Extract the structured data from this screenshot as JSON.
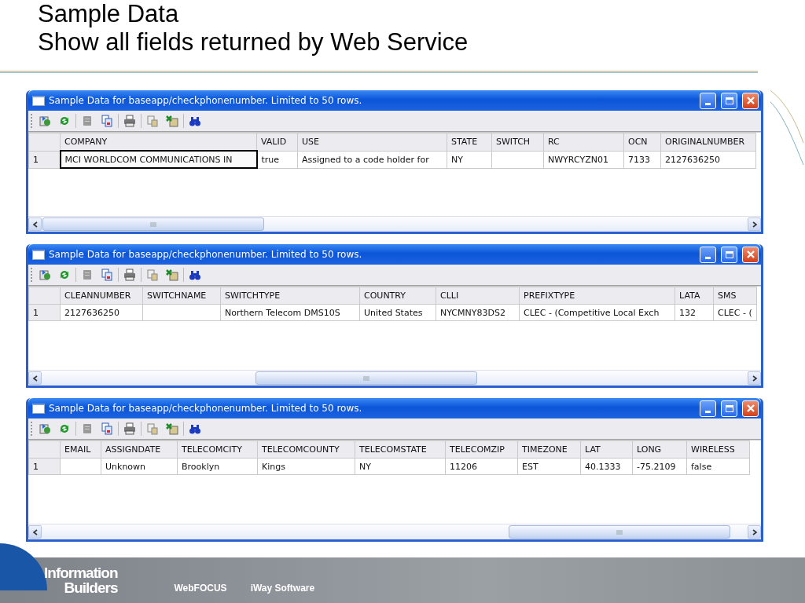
{
  "slide": {
    "title_lines": [
      "Sample Data",
      "Show all fields returned by Web Service"
    ]
  },
  "windows": [
    {
      "title": "Sample Data for baseapp/checkphonenumber. Limited to 50 rows.",
      "columns": [
        "COMPANY",
        "VALID",
        "USE",
        "STATE",
        "SWITCH",
        "RC",
        "OCN",
        "ORIGINALNUMBER"
      ],
      "rows": [
        {
          "number": "1",
          "cells": [
            {
              "text": "MCI WORLDCOM COMMUNICATIONS IN",
              "focused": true
            },
            {
              "text": "true",
              "focused": false
            },
            {
              "text": "Assigned to a code holder for",
              "focused": false
            },
            {
              "text": "NY",
              "focused": false
            },
            {
              "focused": false
            },
            {
              "text": "NWYRCYZN01",
              "focused": false
            },
            {
              "text": "7133",
              "focused": false
            },
            {
              "text": "2127636250",
              "focused": false
            }
          ]
        }
      ]
    },
    {
      "title": "Sample Data for baseapp/checkphonenumber. Limited to 50 rows.",
      "columns": [
        "CLEANNUMBER",
        "SWITCHNAME",
        "SWITCHTYPE",
        "COUNTRY",
        "CLLI",
        "PREFIXTYPE",
        "LATA",
        "SMS"
      ],
      "rows": [
        {
          "number": "1",
          "cells": [
            {
              "text": "2127636250",
              "focused": false
            },
            {
              "focused": false
            },
            {
              "text": "Northern Telecom DMS10S",
              "focused": false
            },
            {
              "text": "United States",
              "focused": false
            },
            {
              "text": "NYCMNY83DS2",
              "focused": false
            },
            {
              "text": "CLEC - (Competitive Local Exch",
              "focused": false
            },
            {
              "text": "132",
              "focused": false
            },
            {
              "text": "CLEC - (",
              "focused": false
            }
          ]
        }
      ]
    },
    {
      "title": "Sample Data for baseapp/checkphonenumber. Limited to 50 rows.",
      "columns": [
        "EMAIL",
        "ASSIGNDATE",
        "TELECOMCITY",
        "TELECOMCOUNTY",
        "TELECOMSTATE",
        "TELECOMZIP",
        "TIMEZONE",
        "LAT",
        "LONG",
        "WIRELESS"
      ],
      "rows": [
        {
          "number": "1",
          "cells": [
            {
              "focused": false
            },
            {
              "text": "Unknown",
              "focused": false
            },
            {
              "text": "Brooklyn",
              "focused": false
            },
            {
              "text": "Kings",
              "focused": false
            },
            {
              "text": "NY",
              "focused": false
            },
            {
              "text": "11206",
              "focused": false
            },
            {
              "text": "EST",
              "focused": false
            },
            {
              "text": "40.1333",
              "focused": false
            },
            {
              "text": "-75.2109",
              "focused": false
            },
            {
              "text": "false",
              "focused": false
            }
          ]
        }
      ]
    }
  ],
  "footer": {
    "logo_lines": [
      "Information",
      "Builders"
    ],
    "products": [
      "WebFOCUS",
      "iWay Software"
    ]
  }
}
